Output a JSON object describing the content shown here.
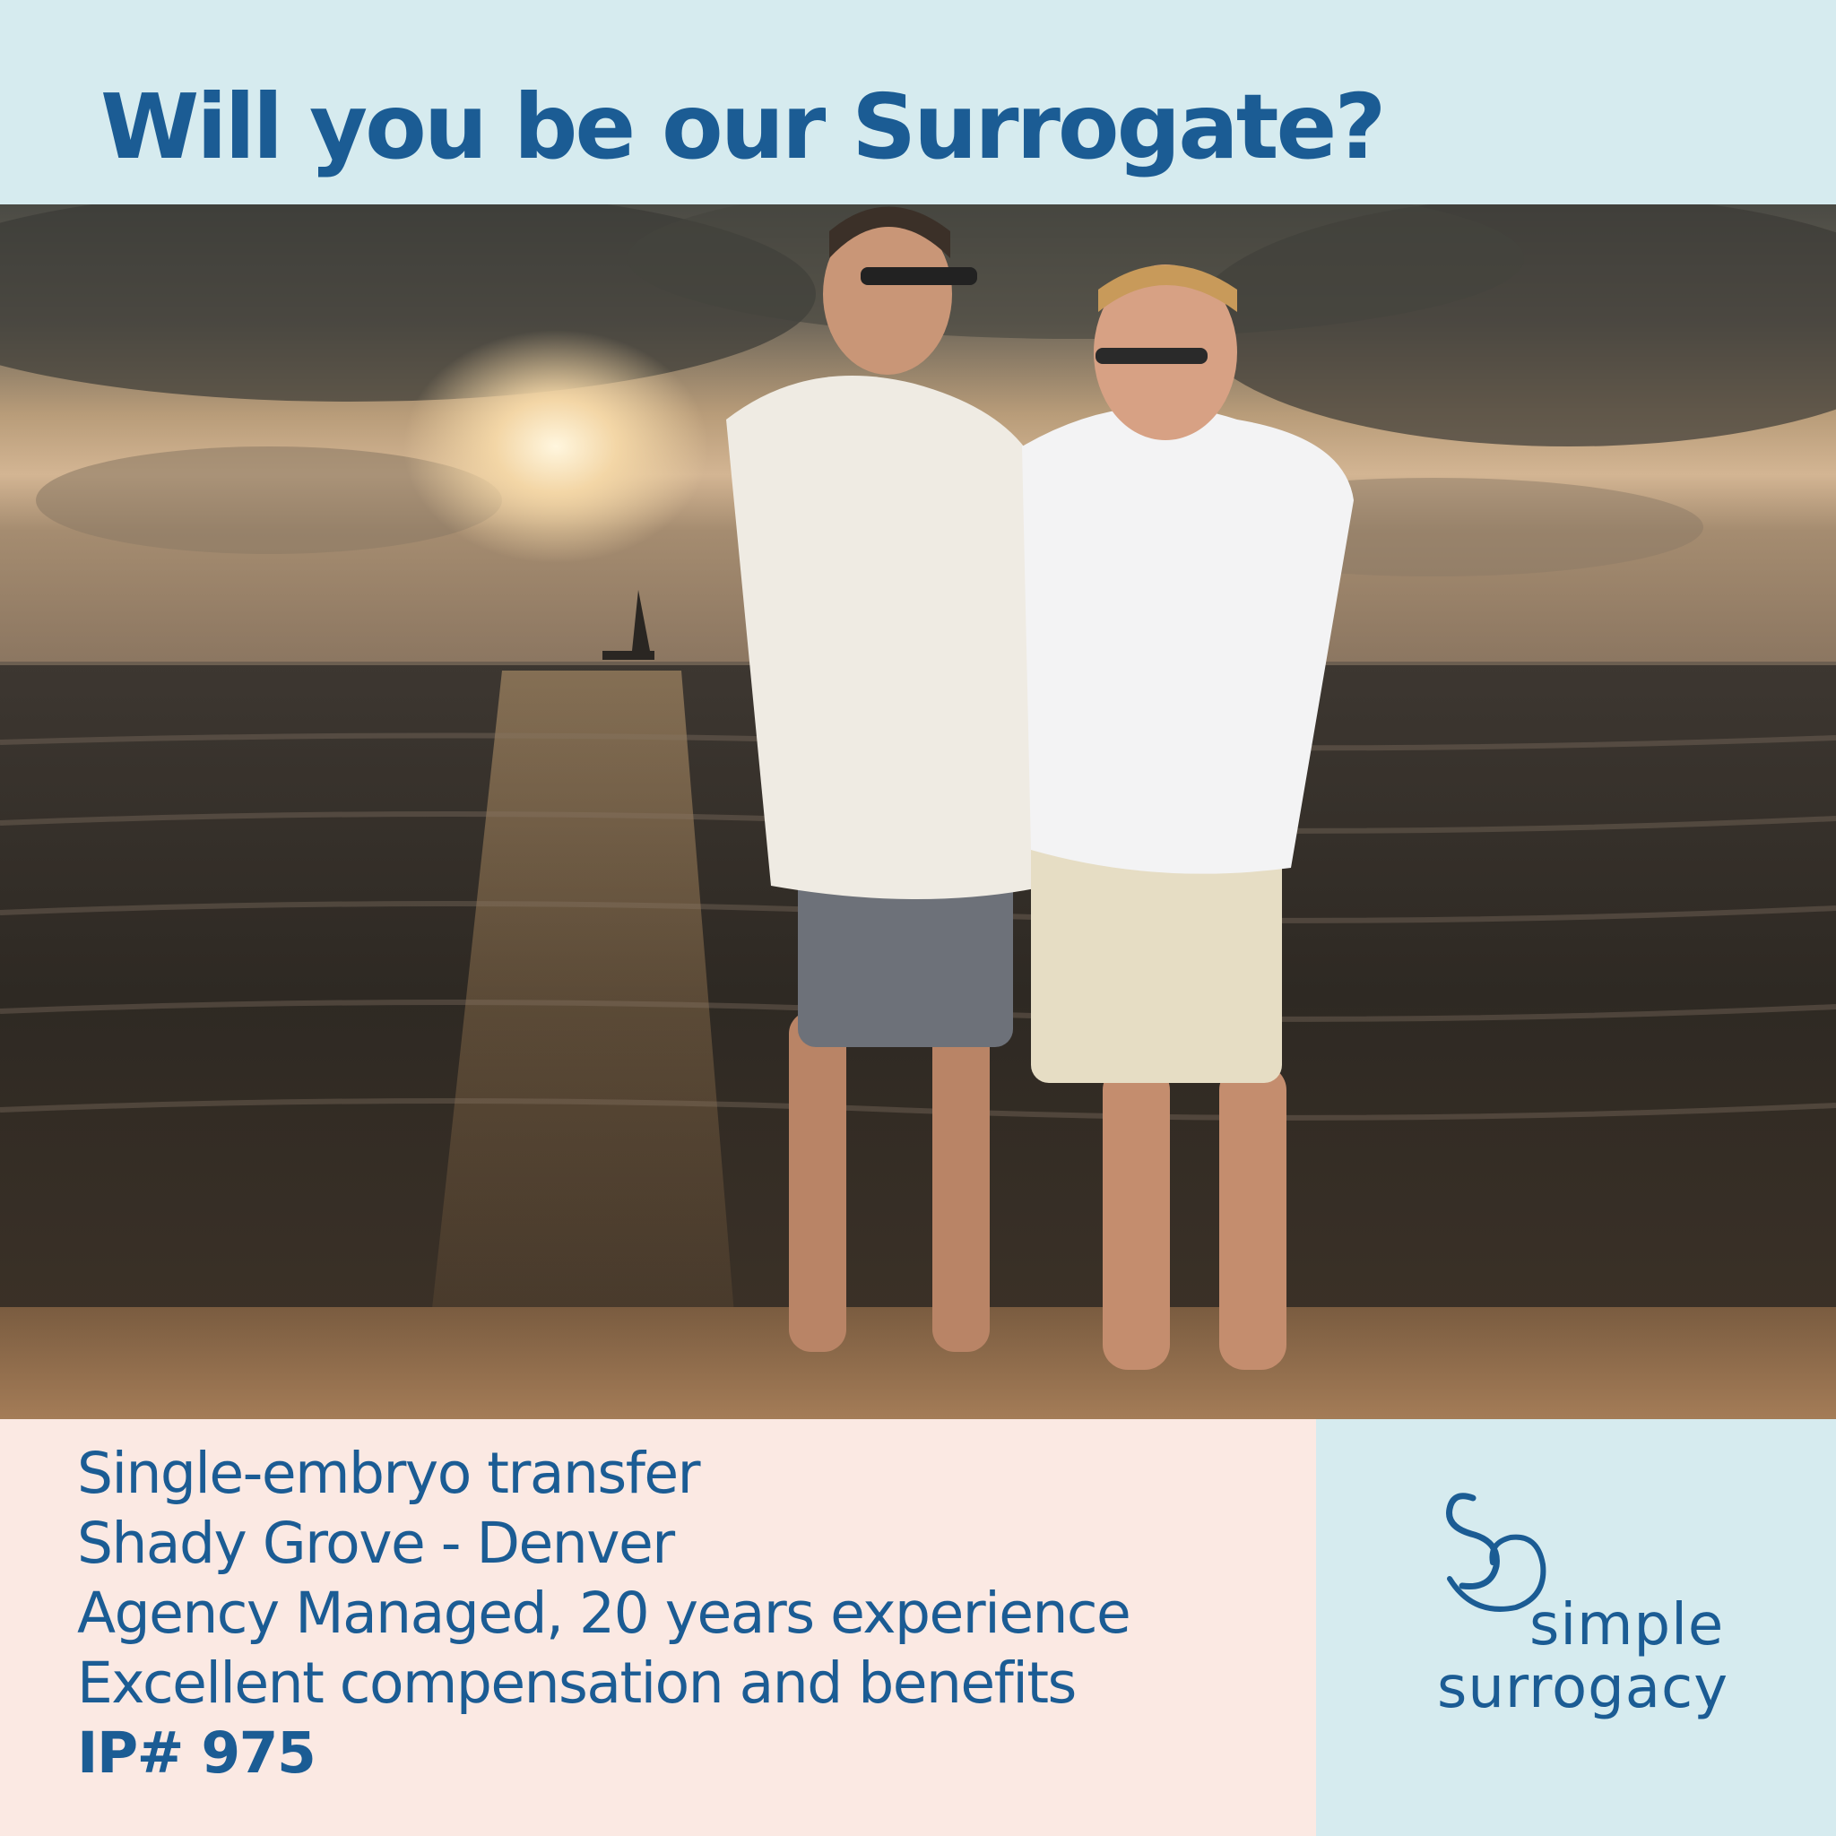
{
  "colors": {
    "brand_blue": "#1b5c94",
    "header_bg": "#d6ebef",
    "info_bg": "#fbe9e3"
  },
  "header": {
    "headline": "Will you be our Surrogate?"
  },
  "photo": {
    "icon": "beach-couple-photo"
  },
  "info": {
    "lines": [
      "Single-embryo transfer",
      "Shady Grove - Denver",
      "Agency Managed, 20 years experience",
      "Excellent compensation and benefits"
    ],
    "id_label": "IP# 975"
  },
  "brand": {
    "icon": "simple-surrogacy-logo-icon",
    "name_line1": "simple",
    "name_line2": "surrogacy"
  }
}
